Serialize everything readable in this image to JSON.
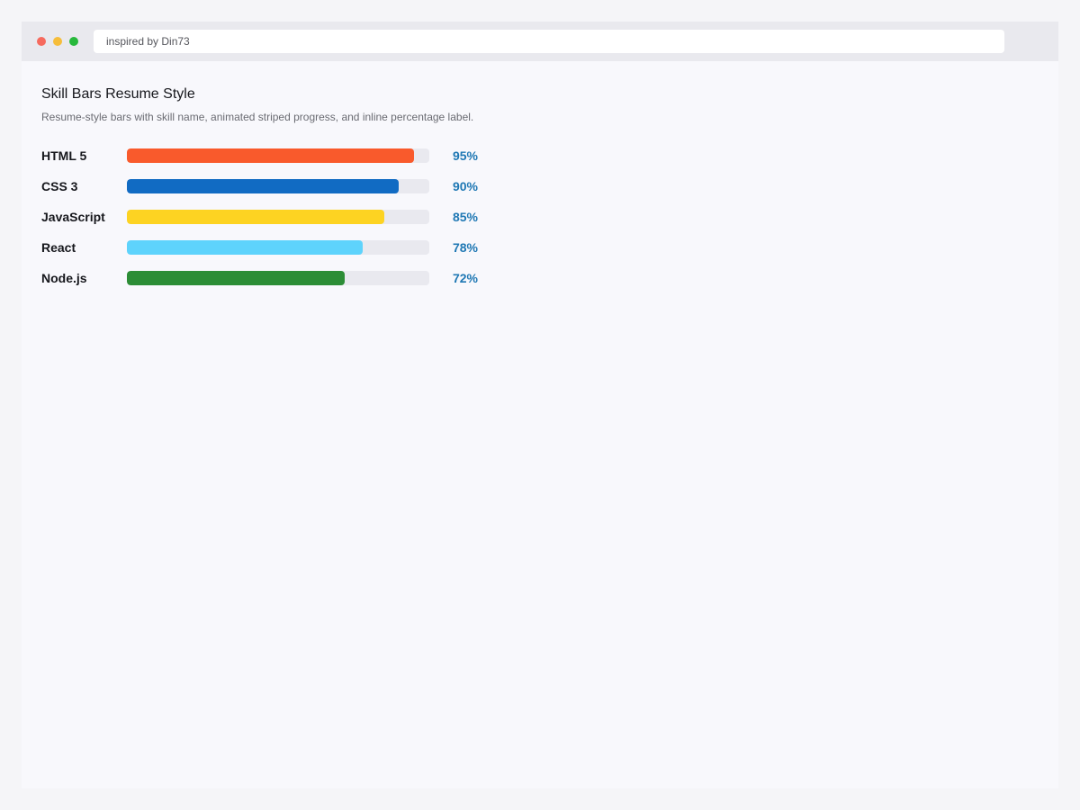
{
  "browser": {
    "url": "inspired by Din73",
    "dots": [
      {
        "name": "close",
        "color": "#f66a5e"
      },
      {
        "name": "minimize",
        "color": "#f6bd3a"
      },
      {
        "name": "maximize",
        "color": "#27b83b"
      }
    ]
  },
  "page": {
    "title": "Skill Bars Resume Style",
    "subtitle": "Resume-style bars with skill name, animated striped progress, and inline percentage label."
  },
  "skills": [
    {
      "name": "HTML 5",
      "percent": 95,
      "label": "95%",
      "color": "#f95a2c"
    },
    {
      "name": "CSS 3",
      "percent": 90,
      "label": "90%",
      "color": "#116bc3"
    },
    {
      "name": "JavaScript",
      "percent": 85,
      "label": "85%",
      "color": "#fdd322"
    },
    {
      "name": "React",
      "percent": 78,
      "label": "78%",
      "color": "#5ed3fc"
    },
    {
      "name": "Node.js",
      "percent": 72,
      "label": "72%",
      "color": "#2c8d36"
    }
  ],
  "accent_color": "#1f78b4"
}
